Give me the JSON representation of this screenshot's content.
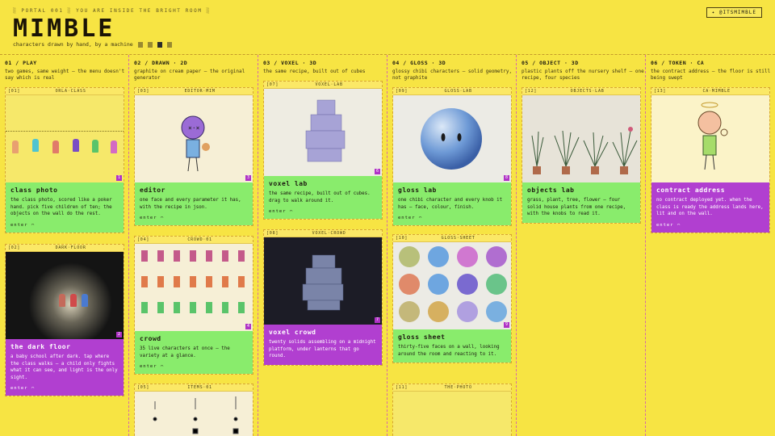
{
  "header": {
    "topbar": "░ PORTAL 001 ░ YOU ARE INSIDE THE BRIGHT ROOM ░",
    "badge": "✦ @ITSMIMBLE",
    "logo": "MIMBLE",
    "tagline": "characters drawn by hand, by a machine"
  },
  "columns": [
    {
      "head": "01 / PLAY",
      "sub": "two games, same weight — the menu doesn't say which is real"
    },
    {
      "head": "02 / DRAWN · 2D",
      "sub": "graphite on cream paper — the original generator"
    },
    {
      "head": "03 / VOXEL · 3D",
      "sub": "the same recipe, built out of cubes"
    },
    {
      "head": "04 / GLOSS · 3D",
      "sub": "glossy chibi characters — solid geometry, not graphite"
    },
    {
      "head": "05 / OBJECT · 3D",
      "sub": "plastic plants off the nursery shelf — one recipe, four species"
    },
    {
      "head": "06 / TOKEN · CA",
      "sub": "the contract address — the floor is still being swept"
    }
  ],
  "cards": {
    "orla": {
      "id": "[01]",
      "tag": "ORLA·CLASS",
      "num": "1",
      "title": "class photo",
      "desc": "the class photo, scored like a poker hand. pick five children of ten; the objects on the wall do the rest.",
      "enter": "enter ⌒"
    },
    "dark": {
      "id": "[02]",
      "tag": "DARK·FLOOR",
      "num": "2",
      "title": "the dark floor",
      "desc": "a baby school after dark. tap where the class walks — a child only fights what it can see, and light is the only sight.",
      "enter": "enter ⌒"
    },
    "editor": {
      "id": "[03]",
      "tag": "EDITOR·MIM",
      "num": "3",
      "title": "editor",
      "desc": "one face and every parameter it has, with the recipe in json.",
      "enter": "enter ⌒"
    },
    "crowd": {
      "id": "[04]",
      "tag": "CROWD·01",
      "num": "4",
      "title": "crowd",
      "desc": "35 live characters at once — the variety at a glance.",
      "enter": "enter ⌒"
    },
    "items": {
      "id": "[05]",
      "tag": "ITEMS·01"
    },
    "voxel": {
      "id": "[07]",
      "tag": "VOXEL·LAB",
      "num": "6",
      "title": "voxel lab",
      "desc": "the same recipe, built out of cubes. drag to walk around it.",
      "enter": "enter ⌒"
    },
    "voxcrowd": {
      "id": "[08]",
      "tag": "VOXEL·CROWD",
      "num": "7",
      "title": "voxel crowd",
      "desc": "twenty solids assembling on a midnight platform, under lanterns that go round.",
      "enter": "enter ⌒"
    },
    "gloss": {
      "id": "[09]",
      "tag": "GLOSS·LAB",
      "num": "8",
      "title": "gloss lab",
      "desc": "one chibi character and every knob it has — face, colour, finish.",
      "enter": "enter ⌒"
    },
    "glosssheet": {
      "id": "[10]",
      "tag": "GLOSS·SHEET",
      "num": "9",
      "title": "gloss sheet",
      "desc": "thirty-five faces on a wall, looking around the room and reacting to it.",
      "enter": "enter ⌒"
    },
    "photo": {
      "id": "[11]",
      "tag": "THE·PHOTO"
    },
    "objects": {
      "id": "[12]",
      "tag": "OBJECTS·LAB",
      "title": "objects lab",
      "desc": "grass, plant, tree, flower — four solid house plants from one recipe, with the knobs to read it."
    },
    "ca": {
      "id": "[13]",
      "tag": "CA·MIMBLE",
      "title": "contract address",
      "desc": "no contract deployed yet. when the class is ready the address lands here, lit and on the wall.",
      "enter": "enter ⌒"
    }
  },
  "colors": {
    "bg": "#f7e443",
    "green": "#89ec6c",
    "purple": "#b13fd0"
  }
}
